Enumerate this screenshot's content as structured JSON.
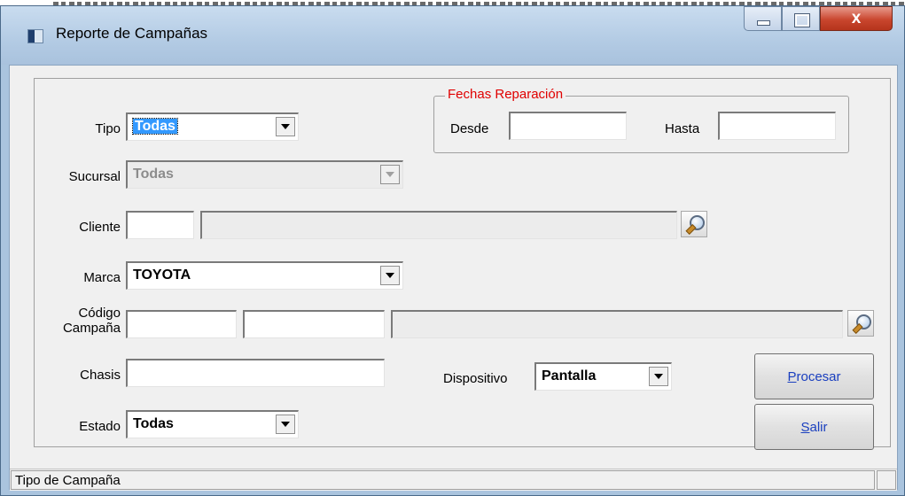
{
  "window": {
    "title": "Reporte de Campañas",
    "close_glyph": "x"
  },
  "form": {
    "tipo": {
      "label": "Tipo",
      "value": "Todas"
    },
    "fechas": {
      "title": "Fechas Reparación",
      "desde_label": "Desde",
      "desde_value": "",
      "hasta_label": "Hasta",
      "hasta_value": ""
    },
    "sucursal": {
      "label": "Sucursal",
      "value": "Todas"
    },
    "cliente": {
      "label": "Cliente",
      "code": "",
      "name": ""
    },
    "marca": {
      "label": "Marca",
      "value": "TOYOTA"
    },
    "codigo_campana": {
      "label_line1": "Código",
      "label_line2": "Campaña",
      "field1": "",
      "field2": "",
      "description": ""
    },
    "chasis": {
      "label": "Chasis",
      "value": ""
    },
    "dispositivo": {
      "label": "Dispositivo",
      "value": "Pantalla"
    },
    "estado": {
      "label": "Estado",
      "value": "Todas"
    }
  },
  "buttons": {
    "procesar": {
      "hotkey": "P",
      "rest": "rocesar"
    },
    "salir": {
      "hotkey": "S",
      "rest": "alir"
    }
  },
  "statusbar": {
    "text": "Tipo de Campaña"
  },
  "icons": {
    "title": "app-window-icon",
    "search": "magnifier-icon"
  }
}
